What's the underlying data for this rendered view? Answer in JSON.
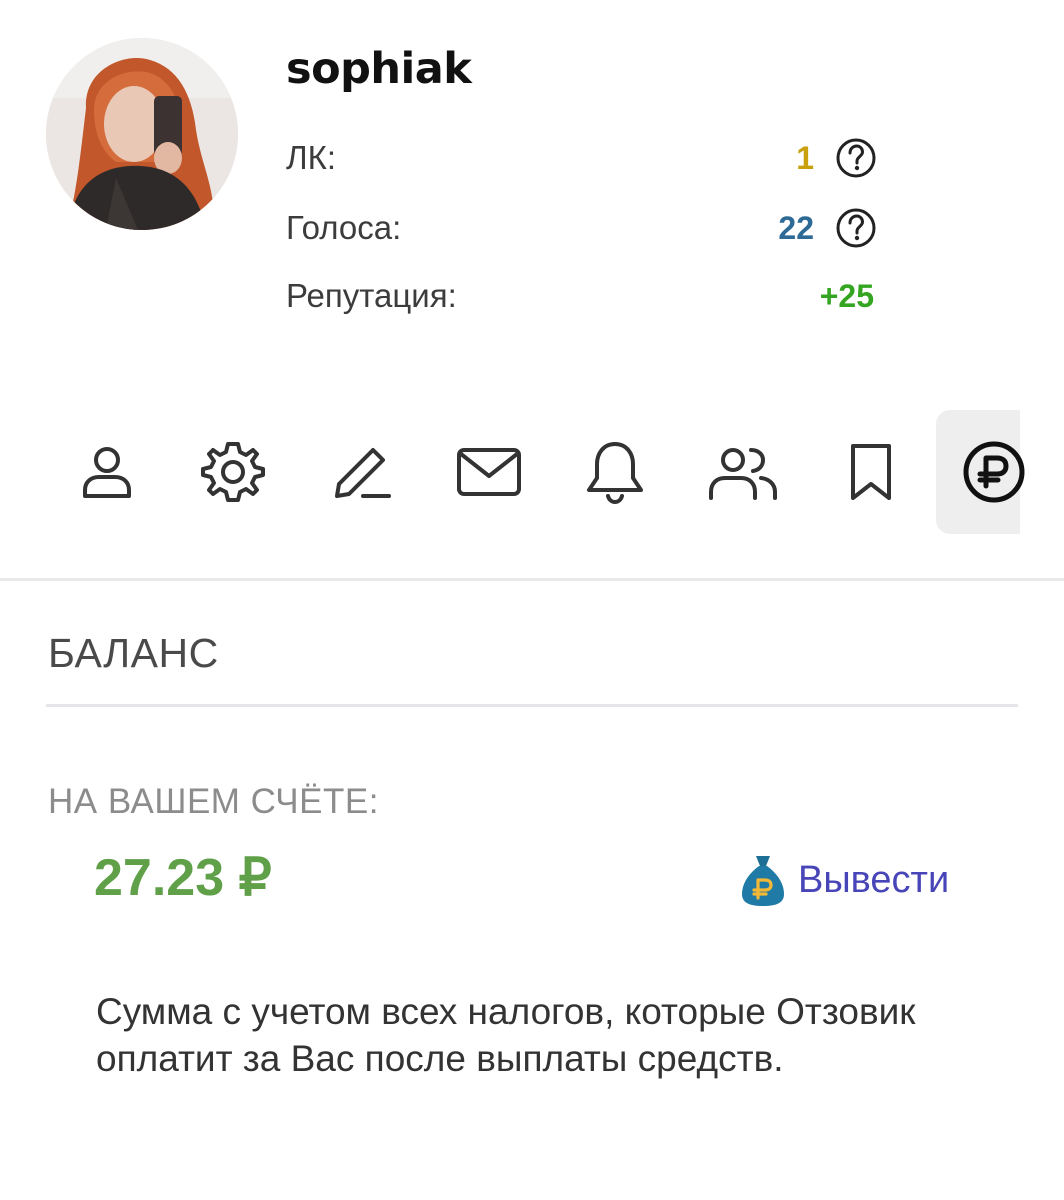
{
  "profile": {
    "username": "sophiak",
    "avatar_icon": "user-photo",
    "stats": [
      {
        "label": "ЛК:",
        "value": "1",
        "color": "#c9a10f",
        "has_help": true
      },
      {
        "label": "Голоса:",
        "value": "22",
        "color": "#2e6a96",
        "has_help": true
      },
      {
        "label": "Репутация:",
        "value": "+25",
        "color": "#34a520",
        "has_help": false
      }
    ]
  },
  "tabs": [
    {
      "icon": "profile-icon",
      "active": false
    },
    {
      "icon": "settings-gear-icon",
      "active": false
    },
    {
      "icon": "edit-pencil-icon",
      "active": false
    },
    {
      "icon": "mail-envelope-icon",
      "active": false
    },
    {
      "icon": "notification-bell-icon",
      "active": false
    },
    {
      "icon": "friends-icon",
      "active": false
    },
    {
      "icon": "bookmark-icon",
      "active": false
    },
    {
      "icon": "ruble-coin-icon",
      "active": true
    }
  ],
  "balance": {
    "section_title": "БАЛАНС",
    "account_label": "НА ВАШЕМ СЧЁТЕ:",
    "amount": "27.23 ₽",
    "amount_color": "#5fa048",
    "withdraw_label": "Вывести",
    "withdraw_icon": "money-bag-icon",
    "link_color": "#4845b8",
    "note": "Сумма с учетом всех налогов, которые Отзовик оплатит за Вас после выплаты средств."
  }
}
